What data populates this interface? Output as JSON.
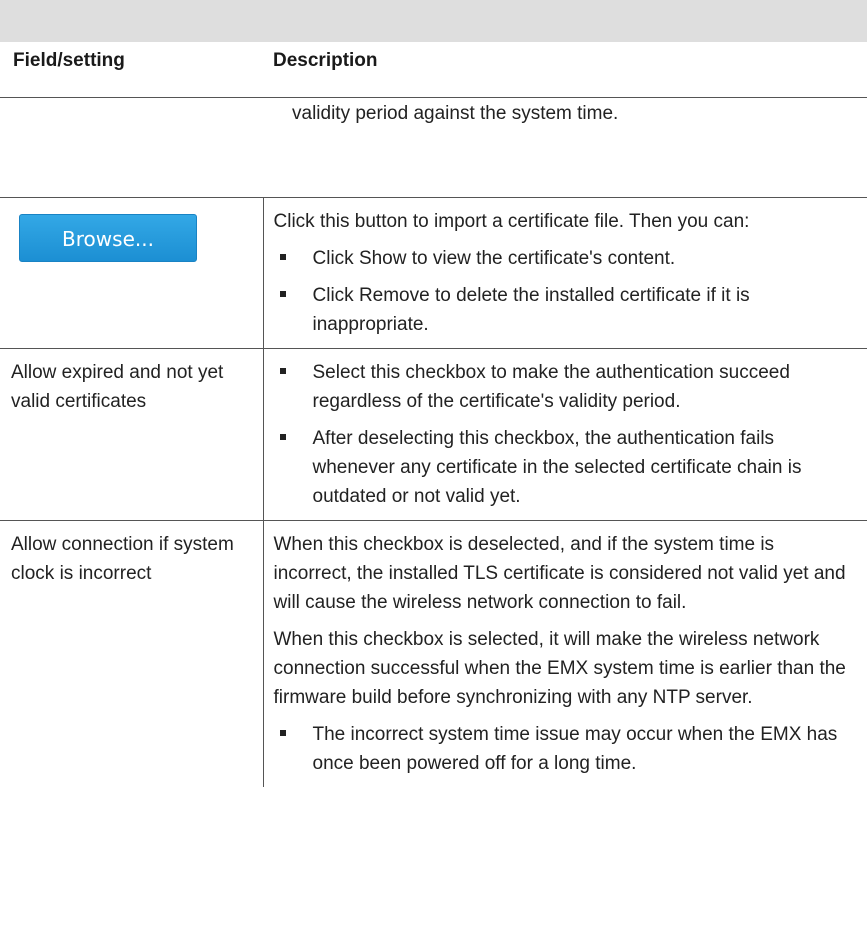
{
  "table": {
    "header": {
      "col1": "Field/setting",
      "col2": "Description"
    },
    "continued_row": {
      "text": "validity period against the system time."
    },
    "rows": [
      {
        "browse_label": "Browse...",
        "intro": "Click this button to import a certificate file. Then you can:",
        "bullets": [
          "Click Show to view the certificate's content.",
          "Click Remove to delete the installed certificate if it is inappropriate."
        ]
      },
      {
        "field": "Allow expired and not yet valid certificates",
        "bullets": [
          "Select this checkbox to make the authentication succeed regardless of the certificate's validity period.",
          "After deselecting this checkbox, the authentication fails whenever any certificate in the selected certificate chain is outdated or not valid yet."
        ]
      },
      {
        "field": "Allow connection if system clock is incorrect",
        "paragraphs": [
          "When this checkbox is deselected, and if the system time is incorrect, the installed TLS certificate is considered not valid yet and will cause the wireless network connection to fail.",
          "When this checkbox is selected, it will make the wireless network connection successful when the EMX system time is earlier than the firmware build before synchronizing with any NTP server."
        ],
        "bullets": [
          "The incorrect system time issue may occur when the EMX has once been powered off for a long time."
        ]
      }
    ]
  }
}
